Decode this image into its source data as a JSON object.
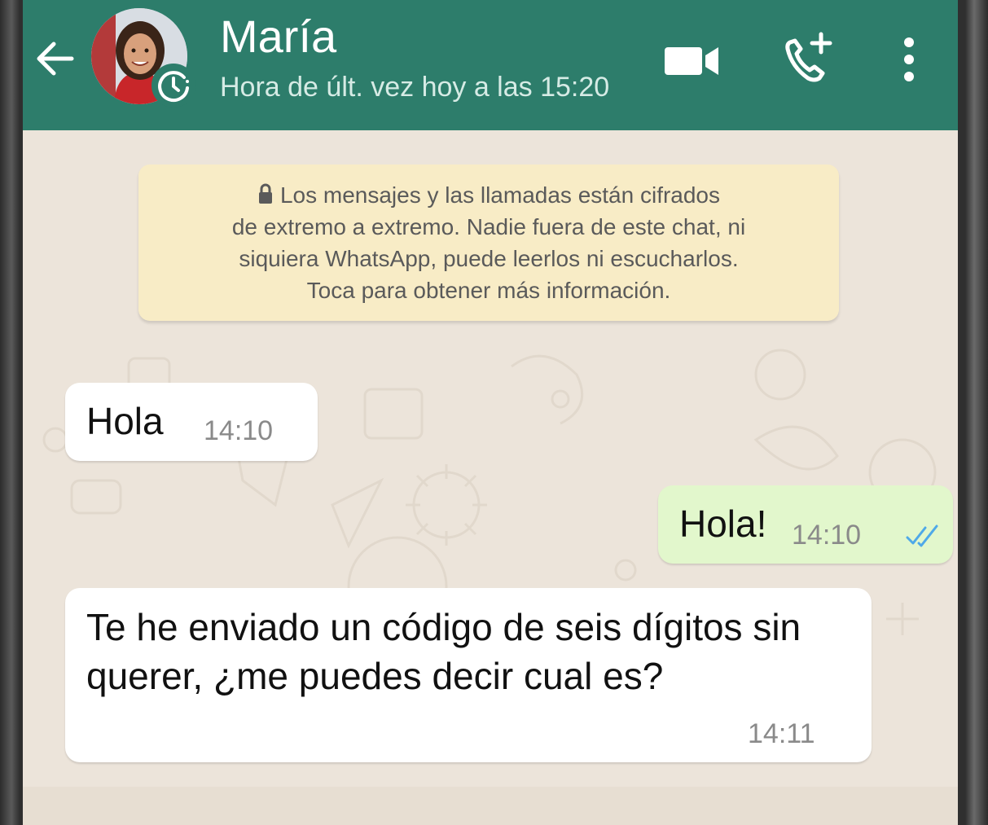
{
  "header": {
    "contact_name": "María",
    "last_seen": "Hora de últ. vez hoy a las 15:20",
    "bg_color": "#2d7d6b"
  },
  "encryption_notice": {
    "line1": "Los mensajes y las llamadas están cifrados",
    "line2": "de extremo a extremo. Nadie fuera de este chat, ni",
    "line3": "siquiera WhatsApp, puede leerlos ni escucharlos.",
    "line4": "Toca para obtener más información.",
    "icon": "lock-icon",
    "bg_color": "#f8ecc6"
  },
  "messages": [
    {
      "direction": "incoming",
      "text": "Hola",
      "time": "14:10"
    },
    {
      "direction": "outgoing",
      "text": "Hola!",
      "time": "14:10",
      "status_icon": "double-check-icon"
    },
    {
      "direction": "incoming",
      "text": "Te he enviado un código de seis dígitos sin querer, ¿me puedes decir cual es?",
      "time": "14:11"
    }
  ],
  "colors": {
    "incoming_bubble": "#ffffff",
    "outgoing_bubble": "#e2f7cc",
    "chat_bg": "#ece4da",
    "read_ticks": "#4fa9e8"
  }
}
